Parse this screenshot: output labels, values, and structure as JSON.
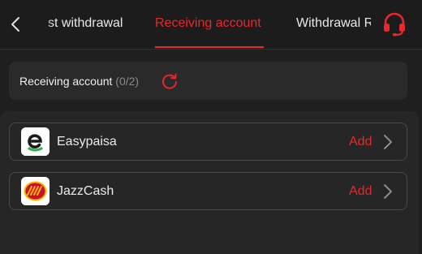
{
  "header": {
    "tabs": [
      {
        "label": "st withdrawal"
      },
      {
        "label": "Receiving account"
      },
      {
        "label": "Withdrawal R"
      }
    ],
    "active_tab_color": "#e8282b",
    "icons": {
      "back": "chevron-left-icon",
      "support": "headset-icon"
    }
  },
  "summary": {
    "label": "Receiving account",
    "count": "(0/2)",
    "icon": "refresh-icon"
  },
  "accounts": [
    {
      "name": "Easypaisa",
      "action": "Add",
      "logo": "easypaisa-logo"
    },
    {
      "name": "JazzCash",
      "action": "Add",
      "logo": "jazzcash-logo"
    }
  ]
}
